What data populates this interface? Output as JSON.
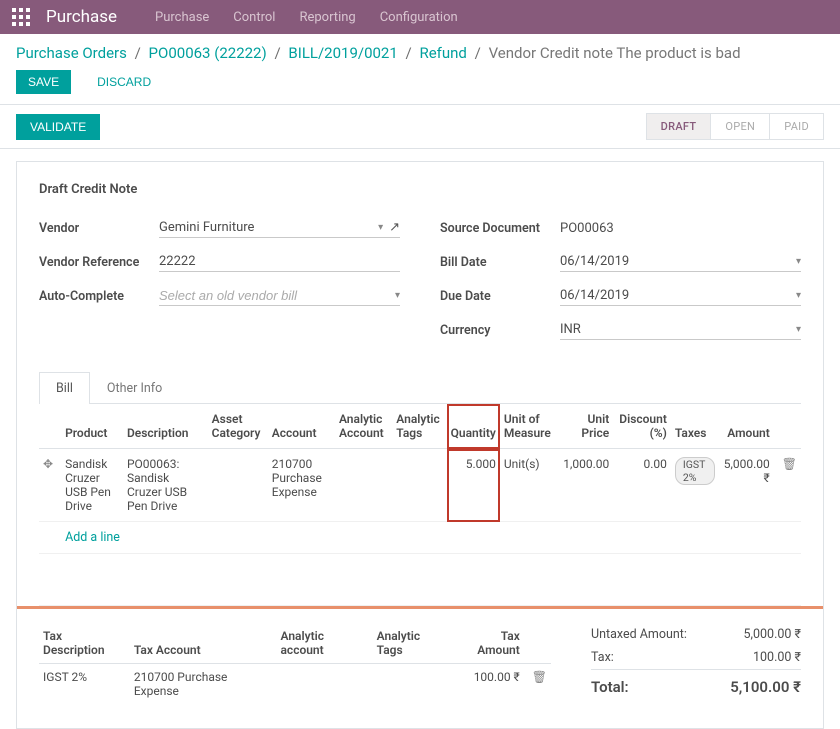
{
  "topbar": {
    "app_title": "Purchase",
    "menu": [
      "Purchase",
      "Control",
      "Reporting",
      "Configuration"
    ]
  },
  "breadcrumb": {
    "items": [
      "Purchase Orders",
      "PO00063 (22222)",
      "BILL/2019/0021",
      "Refund"
    ],
    "current": "Vendor Credit note The product is bad"
  },
  "actions": {
    "save": "SAVE",
    "discard": "DISCARD",
    "validate": "VALIDATE"
  },
  "status": {
    "steps": [
      "DRAFT",
      "OPEN",
      "PAID"
    ],
    "active_index": 0
  },
  "form": {
    "title": "Draft Credit Note",
    "left": {
      "vendor_label": "Vendor",
      "vendor": "Gemini Furniture",
      "vendor_ref_label": "Vendor Reference",
      "vendor_ref": "22222",
      "auto_label": "Auto-Complete",
      "auto_placeholder": "Select an old vendor bill"
    },
    "right": {
      "source_label": "Source Document",
      "source": "PO00063",
      "billdate_label": "Bill Date",
      "billdate": "06/14/2019",
      "duedate_label": "Due Date",
      "duedate": "06/14/2019",
      "currency_label": "Currency",
      "currency": "INR"
    }
  },
  "tabs": {
    "bill": "Bill",
    "other": "Other Info"
  },
  "lines": {
    "headers": {
      "product": "Product",
      "description": "Description",
      "asset": "Asset Category",
      "account": "Account",
      "analytic_account": "Analytic Account",
      "analytic_tags": "Analytic Tags",
      "quantity": "Quantity",
      "uom": "Unit of Measure",
      "price": "Unit Price",
      "discount": "Discount (%)",
      "taxes": "Taxes",
      "amount": "Amount"
    },
    "row": {
      "product": "Sandisk Cruzer USB Pen Drive",
      "description": "PO00063: Sandisk Cruzer USB Pen Drive",
      "account": "210700 Purchase Expense",
      "quantity": "5.000",
      "uom": "Unit(s)",
      "price": "1,000.00",
      "discount": "0.00",
      "tax": "IGST 2%",
      "amount": "5,000.00 ₹"
    },
    "add_line": "Add a line"
  },
  "taxfooter": {
    "headers": {
      "desc": "Tax Description",
      "account": "Tax Account",
      "analytic": "Analytic account",
      "tags": "Analytic Tags",
      "amount": "Tax Amount"
    },
    "row": {
      "desc": "IGST 2%",
      "account": "210700 Purchase Expense",
      "amount": "100.00 ₹"
    }
  },
  "totals": {
    "untaxed_label": "Untaxed Amount:",
    "untaxed": "5,000.00 ₹",
    "tax_label": "Tax:",
    "tax": "100.00 ₹",
    "total_label": "Total:",
    "total": "5,100.00 ₹"
  }
}
